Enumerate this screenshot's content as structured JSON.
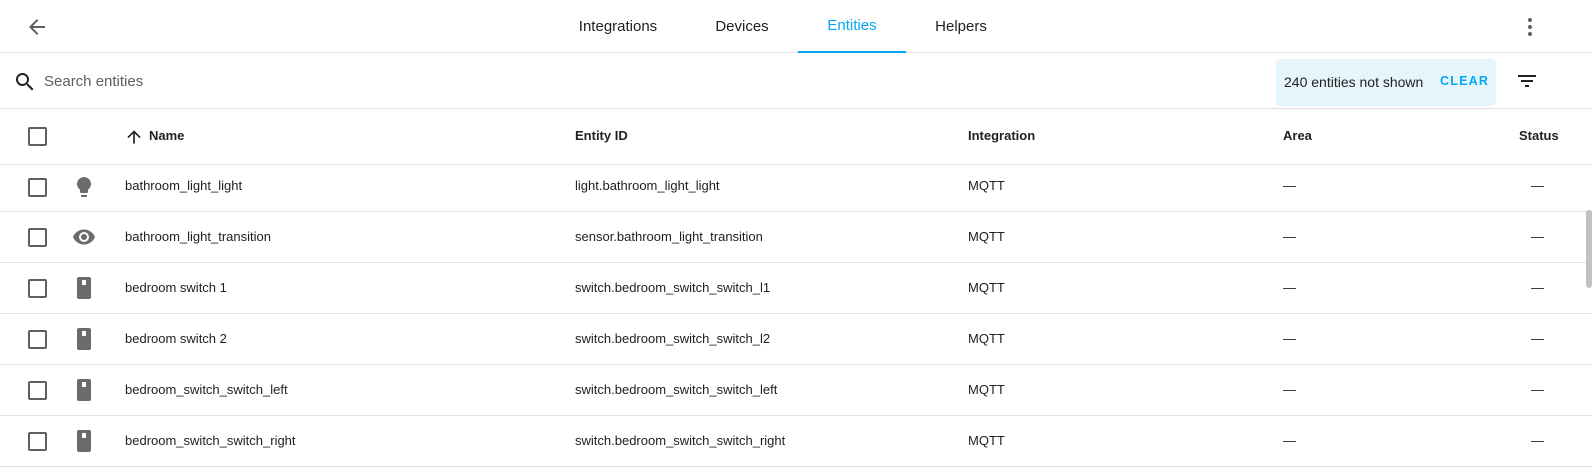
{
  "nav": {
    "tabs": [
      {
        "label": "Integrations",
        "active": false
      },
      {
        "label": "Devices",
        "active": false
      },
      {
        "label": "Entities",
        "active": true
      },
      {
        "label": "Helpers",
        "active": false
      }
    ]
  },
  "search": {
    "placeholder": "Search entities",
    "value": ""
  },
  "filter": {
    "hidden_text": "240 entities not shown",
    "clear_label": "CLEAR"
  },
  "table": {
    "columns": [
      "Name",
      "Entity ID",
      "Integration",
      "Area",
      "Status"
    ],
    "sort": {
      "column": "Name",
      "direction": "ascending"
    },
    "rows": [
      {
        "icon": "lightbulb-icon",
        "name": "bathroom_light_light",
        "entity_id": "light.bathroom_light_light",
        "integration": "MQTT",
        "area": "—",
        "status": "—"
      },
      {
        "icon": "eye-icon",
        "name": "bathroom_light_transition",
        "entity_id": "sensor.bathroom_light_transition",
        "integration": "MQTT",
        "area": "—",
        "status": "—"
      },
      {
        "icon": "light-switch-icon",
        "name": "bedroom switch 1",
        "entity_id": "switch.bedroom_switch_switch_l1",
        "integration": "MQTT",
        "area": "—",
        "status": "—"
      },
      {
        "icon": "light-switch-icon",
        "name": "bedroom switch 2",
        "entity_id": "switch.bedroom_switch_switch_l2",
        "integration": "MQTT",
        "area": "—",
        "status": "—"
      },
      {
        "icon": "light-switch-icon",
        "name": "bedroom_switch_switch_left",
        "entity_id": "switch.bedroom_switch_switch_left",
        "integration": "MQTT",
        "area": "—",
        "status": "—"
      },
      {
        "icon": "light-switch-icon",
        "name": "bedroom_switch_switch_right",
        "entity_id": "switch.bedroom_switch_switch_right",
        "integration": "MQTT",
        "area": "—",
        "status": "—"
      }
    ]
  },
  "colors": {
    "accent": "#03a9f4",
    "banner_bg": "#e6f4fb",
    "icon": "#5f5f5f",
    "divider": "#e0e0e0"
  }
}
